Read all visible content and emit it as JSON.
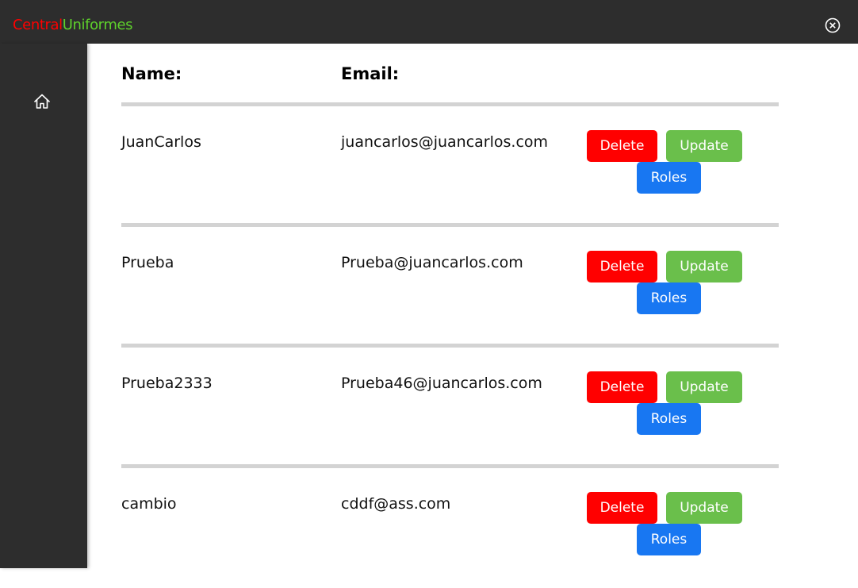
{
  "app": {
    "brand_part1": "Central",
    "brand_part2": "Uniformes",
    "brand_color1": "#ff0000",
    "brand_color2": "#5ed12c"
  },
  "window": {
    "close_icon": "circle-x-icon"
  },
  "sidebar": {
    "home_icon": "home-icon"
  },
  "table": {
    "headers": {
      "name": "Name:",
      "email": "Email:"
    },
    "button_labels": {
      "delete": "Delete",
      "update": "Update",
      "roles": "Roles"
    },
    "rows": [
      {
        "name": "JuanCarlos",
        "email": "juancarlos@juancarlos.com"
      },
      {
        "name": "Prueba",
        "email": "Prueba@juancarlos.com"
      },
      {
        "name": "Prueba2333",
        "email": "Prueba46@juancarlos.com"
      },
      {
        "name": "cambio",
        "email": "cddf@ass.com"
      }
    ]
  },
  "colors": {
    "delete": "#ff0000",
    "update": "#6abf4b",
    "roles": "#1877f2",
    "chrome": "#2d2d2d",
    "divider": "#d3d3d3"
  }
}
